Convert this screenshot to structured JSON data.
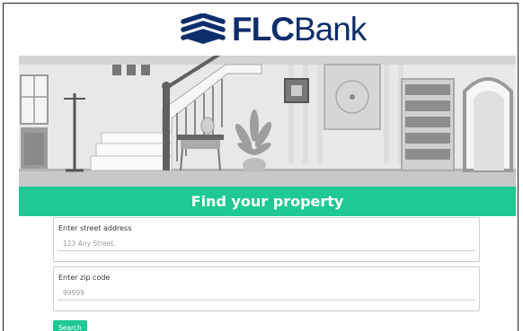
{
  "brand": {
    "name_bold": "FLC",
    "name_thin": "Bank",
    "color": "#0e2e6b",
    "accent": "#1fc993"
  },
  "hero": {
    "title": "Find your property"
  },
  "form": {
    "street": {
      "label": "Enter street address",
      "placeholder": "123 Any Street."
    },
    "zip": {
      "label": "Enter zip code",
      "placeholder": "99999"
    },
    "search_label": "Search"
  }
}
